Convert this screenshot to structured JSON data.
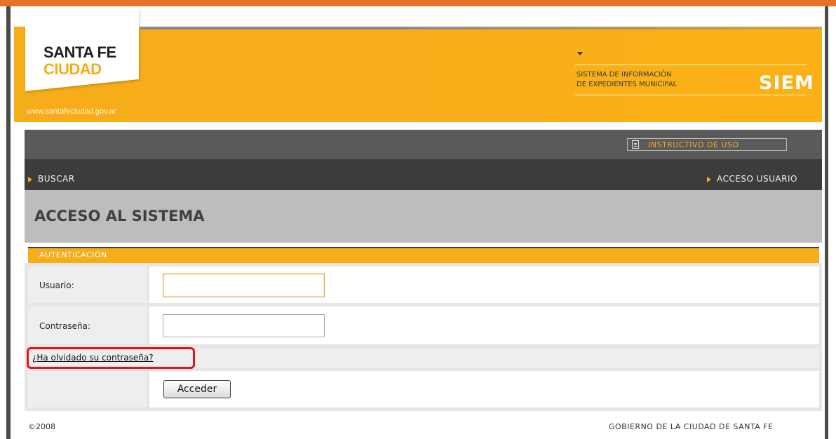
{
  "header": {
    "logo_line1": "SANTA FE",
    "logo_line2": "CIUDAD",
    "site_url": "www.santafeciudad.gov.ar",
    "system_name_line1": "SISTEMA DE INFORMACIÓN",
    "system_name_line2": "DE EXPEDIENTES MUNICIPAL",
    "system_acronym": "SIEM"
  },
  "toolbar": {
    "instructivo_label": "INSTRUCTIVO DE USO"
  },
  "menu": {
    "buscar_label": "BUSCAR",
    "acceso_usuario_label": "ACCESO USUARIO"
  },
  "page": {
    "title": "ACCESO AL SISTEMA"
  },
  "auth": {
    "section_title": "AUTENTICACIÓN",
    "usuario_label": "Usuario:",
    "usuario_value": "",
    "contrasena_label": "Contraseña:",
    "contrasena_value": "",
    "forgot_link": "¿Ha olvidado su contraseña?",
    "submit_label": "Acceder"
  },
  "footer": {
    "copyright": "©2008",
    "government": "GOBIERNO DE LA CIUDAD DE SANTA FE"
  },
  "colors": {
    "accent": "#f7ad19",
    "topbar": "#e8722c",
    "menu_dark": "#3c3c3c",
    "highlight": "#e0141e"
  },
  "icons": {
    "instructivo": "document-icon",
    "menu_arrow": "triangle-right-icon"
  }
}
